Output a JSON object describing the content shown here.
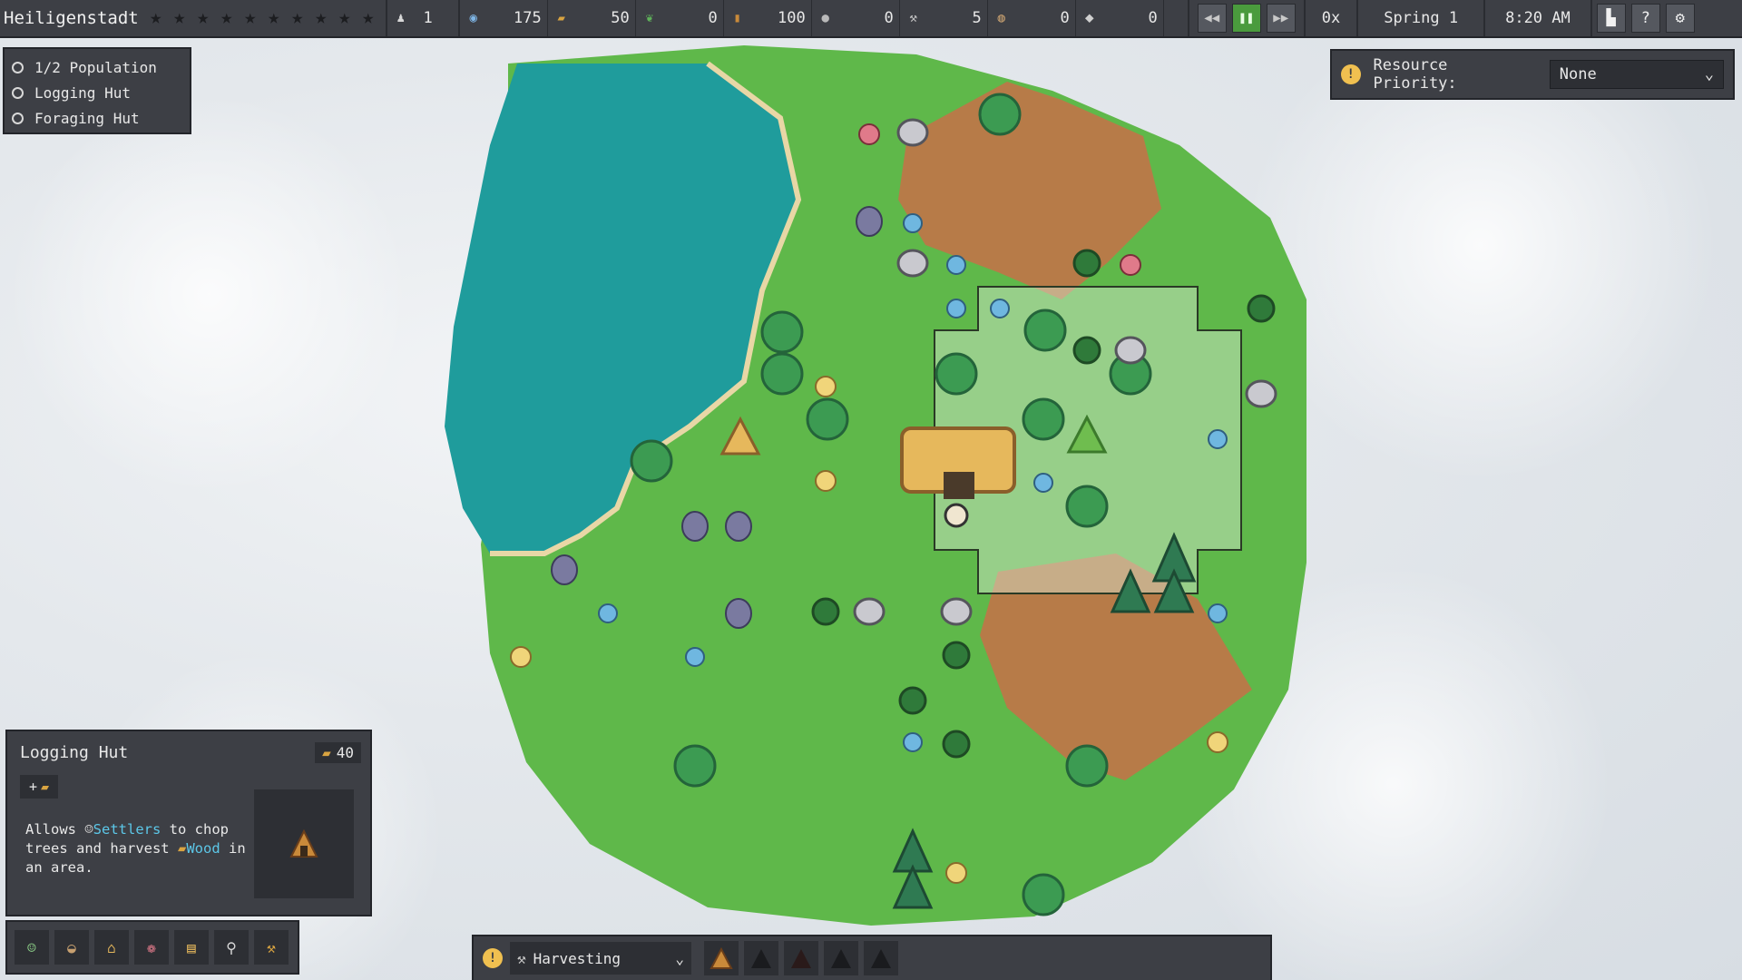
{
  "topbar": {
    "town_name": "Heiligenstadt",
    "stars_count": 10,
    "population": "1",
    "resources": [
      {
        "icon": "settlers-icon",
        "value": "175",
        "color": "#7fb6e6"
      },
      {
        "icon": "wood-icon",
        "value": "50",
        "color": "#d9a441"
      },
      {
        "icon": "herb-icon",
        "value": "0",
        "color": "#5fb35a"
      },
      {
        "icon": "plank-icon",
        "value": "100",
        "color": "#c98a3a"
      },
      {
        "icon": "stone-icon",
        "value": "0",
        "color": "#b9b9b9"
      },
      {
        "icon": "tool-icon",
        "value": "5",
        "color": "#c7c7c7"
      },
      {
        "icon": "food-icon",
        "value": "0",
        "color": "#c7a070"
      },
      {
        "icon": "metal-icon",
        "value": "0",
        "color": "#d0d0d0"
      }
    ],
    "speed": "0x",
    "season": "Spring 1",
    "time": "8:20 AM"
  },
  "objectives": [
    {
      "label": "1/2 Population"
    },
    {
      "label": "Logging Hut"
    },
    {
      "label": "Foraging Hut"
    }
  ],
  "priority": {
    "label": "Resource Priority:",
    "value": "None"
  },
  "info": {
    "title": "Logging Hut",
    "cost": "40",
    "plus": "+",
    "desc_1": "Allows ",
    "desc_settlers": "Settlers",
    "desc_2": " to chop trees and harvest ",
    "desc_wood": "Wood",
    "desc_3": " in an area."
  },
  "bottom": {
    "category": "Harvesting"
  },
  "colors": {
    "grass": "#5fb84a",
    "dirt": "#b77b48",
    "water": "#1f9c9c",
    "panel": "#3d3f45",
    "accent": "#4a9b3d"
  }
}
